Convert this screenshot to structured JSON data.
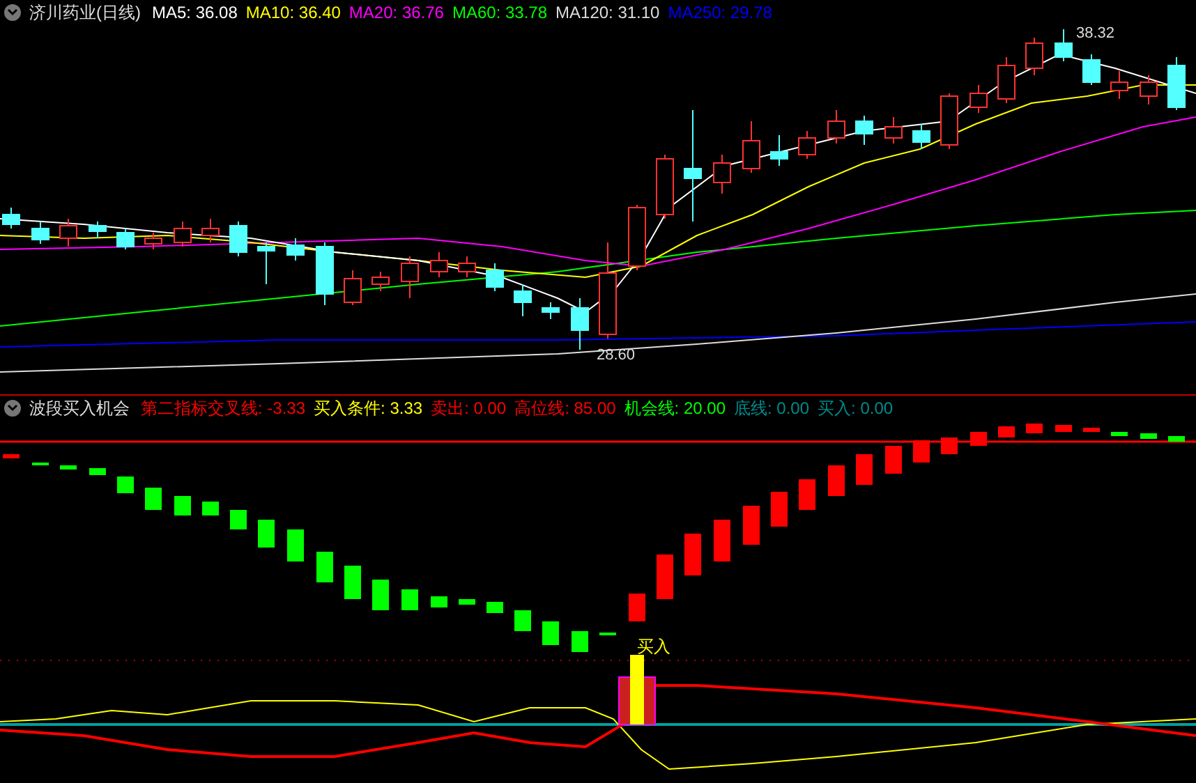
{
  "main_chart": {
    "title": "济川药业(日线)",
    "indicators": [
      {
        "label": "MA5: 36.08",
        "color": "#ffffff"
      },
      {
        "label": "MA10: 36.40",
        "color": "#ffff00"
      },
      {
        "label": "MA20: 36.76",
        "color": "#ff00ff"
      },
      {
        "label": "MA60: 33.78",
        "color": "#00ff00"
      },
      {
        "label": "MA120: 31.10",
        "color": "#dddddd"
      },
      {
        "label": "MA250: 29.78",
        "color": "#0000ff"
      }
    ],
    "high_label": "38.32",
    "low_label": "28.60"
  },
  "sub_chart": {
    "title": "波段买入机会",
    "indicators": [
      {
        "label": "第二指标交叉线: -3.33",
        "color": "#ff0000"
      },
      {
        "label": "买入条件: 3.33",
        "color": "#ffff00"
      },
      {
        "label": "卖出: 0.00",
        "color": "#ff0000"
      },
      {
        "label": "高位线: 85.00",
        "color": "#ff0000"
      },
      {
        "label": "机会线: 20.00",
        "color": "#00ff00"
      },
      {
        "label": "底线: 0.00",
        "color": "#008b8b"
      },
      {
        "label": "买入: 0.00",
        "color": "#008b8b"
      }
    ],
    "signal_label": "买入"
  }
}
